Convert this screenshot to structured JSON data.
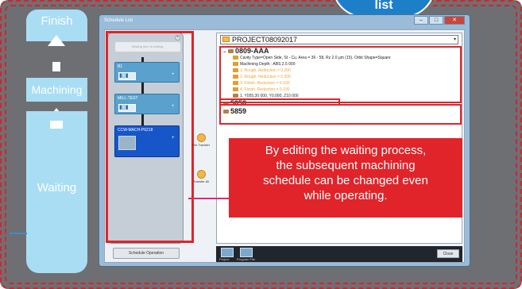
{
  "flow": {
    "finish_label": "Finish",
    "machining_label": "Machining",
    "waiting_label": "Waiting"
  },
  "badge": {
    "text": "list"
  },
  "window": {
    "title": "Schedule List",
    "minimize_icon": "minimize-icon",
    "maximize_icon": "maximize-icon",
    "close_icon": "close-icon"
  },
  "left_panel": {
    "waiting_header": "Waiting item is waiting.",
    "jobs": [
      {
        "label": "B1",
        "selected": false
      },
      {
        "label": "MILL-TEST",
        "selected": false
      },
      {
        "label": "CCW-MACH-P6218",
        "selected": true
      }
    ],
    "schedule_operation_label": "Schedule Operation"
  },
  "middle_tools": {
    "file_transfer_label": "File Transfer",
    "transfer_all_label": "Transfer All"
  },
  "project": {
    "name": "PROJECT08092017",
    "root_node": "0809-AAA",
    "rows": [
      {
        "text": "Cavity Type=Open Side, St - Cu. Area = 36 - 58, Rz 2.0 μm (15), Orbit Shape=Square",
        "color": "black"
      },
      {
        "text": "Machining Depth : ABS 2.5 000",
        "color": "black"
      },
      {
        "text": "1. Rough. Reduction = 0.200",
        "color": "orange"
      },
      {
        "text": "2. Rough. Reduction = 0.200",
        "color": "orange"
      },
      {
        "text": "3. Finish. Reduction = 0.100",
        "color": "orange"
      },
      {
        "text": "4. Finish. Reduction = 0.100",
        "color": "orange"
      },
      {
        "text": "1. Y055.30 000, Y0.000, Z10 000",
        "color": "blue"
      }
    ],
    "sub_nodes": [
      "5858",
      "5859"
    ]
  },
  "callout": {
    "line1": "By editing the waiting process,",
    "line2": "the subsequent machining",
    "line3": "schedule can be changed even",
    "line4": "while operating."
  },
  "bottom": {
    "project_tab": "Project",
    "program_file_tab": "Program File",
    "close_label": "Close"
  },
  "colors": {
    "accent_red": "#e0242a",
    "flow_blue": "#a9ddf4",
    "badge_blue": "#1e7fc9",
    "selected_job": "#1756c9"
  }
}
